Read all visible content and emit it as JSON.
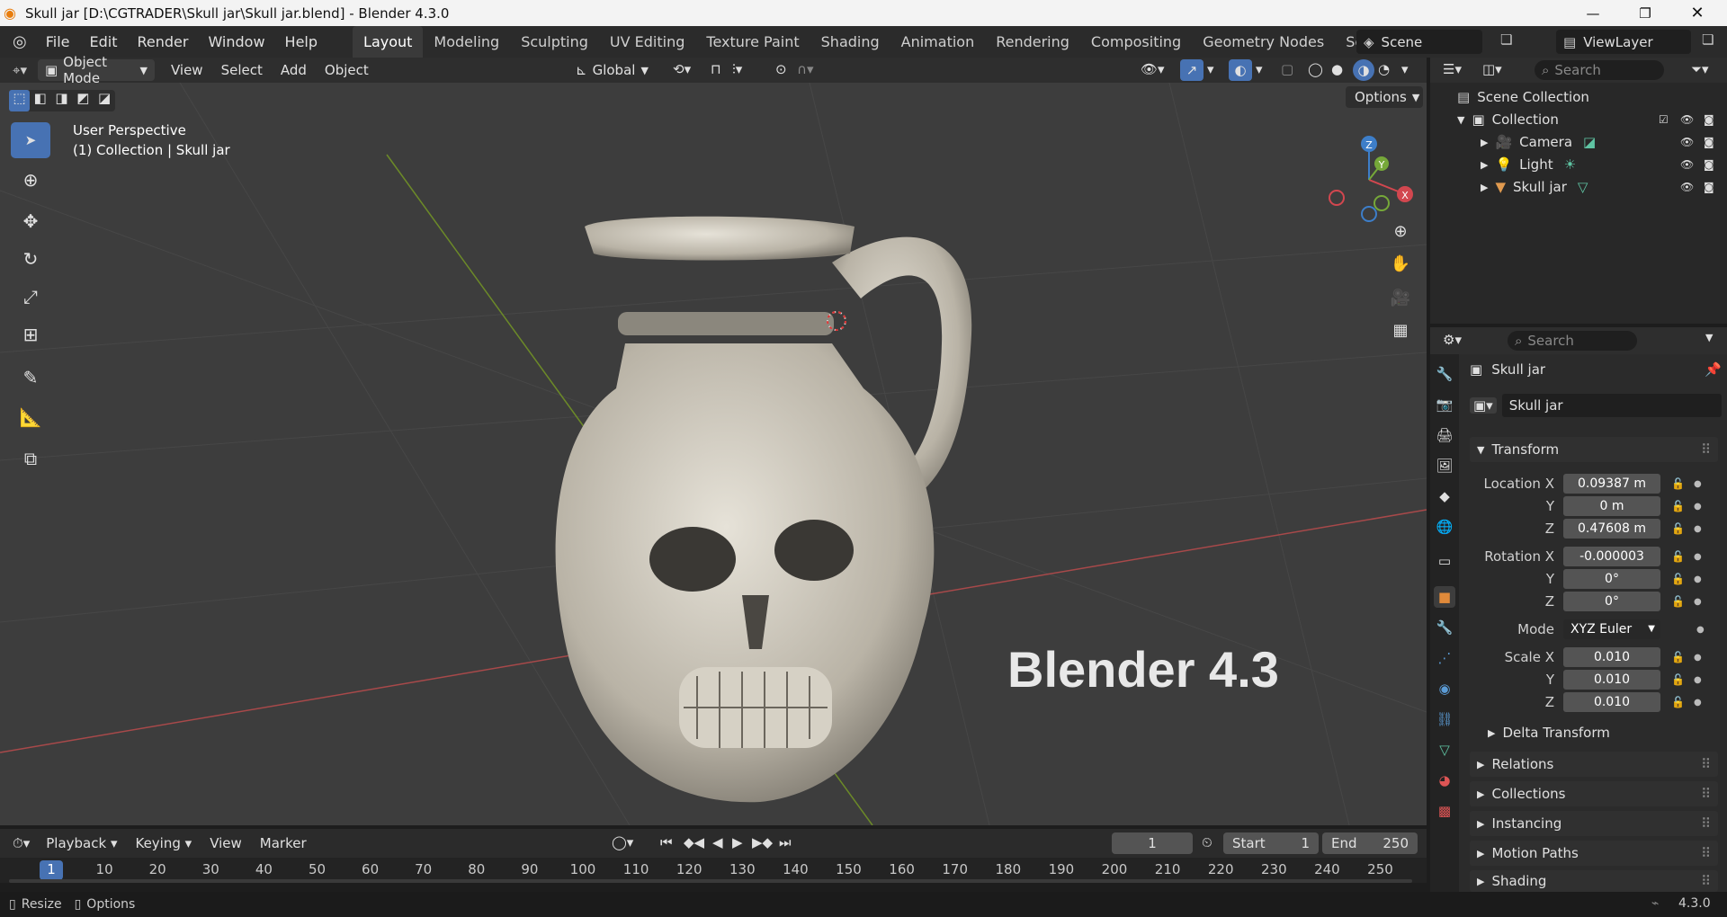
{
  "window": {
    "title": "Skull jar [D:\\CGTRADER\\Skull jar\\Skull jar.blend] - Blender 4.3.0"
  },
  "menu": [
    "File",
    "Edit",
    "Render",
    "Window",
    "Help"
  ],
  "workspaces": [
    "Layout",
    "Modeling",
    "Sculpting",
    "UV Editing",
    "Texture Paint",
    "Shading",
    "Animation",
    "Rendering",
    "Compositing",
    "Geometry Nodes",
    "Scripting"
  ],
  "scene": {
    "name": "Scene",
    "viewlayer": "ViewLayer"
  },
  "viewport": {
    "mode": "Object Mode",
    "menus": [
      "View",
      "Select",
      "Add",
      "Object"
    ],
    "orientation": "Global",
    "options": "Options",
    "overlay_line1": "User Perspective",
    "overlay_line2": "(1) Collection | Skull jar",
    "watermark": "Blender 4.3",
    "gizmo": {
      "z": "Z",
      "y": "Y",
      "x": "X"
    }
  },
  "outliner": {
    "search": "Search",
    "scene_collection": "Scene Collection",
    "collection": "Collection",
    "items": [
      "Camera",
      "Light",
      "Skull jar"
    ]
  },
  "properties": {
    "search": "Search",
    "object_name": "Skull jar",
    "data_name": "Skull jar",
    "transform": "Transform",
    "location": {
      "label": "Location X",
      "x": "0.09387 m",
      "y": "0 m",
      "z": "0.47608 m"
    },
    "rotation": {
      "label": "Rotation X",
      "x": "-0.000003",
      "y": "0°",
      "z": "0°"
    },
    "mode": {
      "label": "Mode",
      "value": "XYZ Euler"
    },
    "scale": {
      "label": "Scale X",
      "x": "0.010",
      "y": "0.010",
      "z": "0.010"
    },
    "axis_y": "Y",
    "axis_z": "Z",
    "panels": [
      "Delta Transform",
      "Relations",
      "Collections",
      "Instancing",
      "Motion Paths",
      "Shading"
    ]
  },
  "timeline": {
    "menus": [
      "Playback",
      "Keying",
      "View",
      "Marker"
    ],
    "current_frame": "1",
    "start_label": "Start",
    "start": "1",
    "end_label": "End",
    "end": "250",
    "ticks": [
      "1",
      "10",
      "20",
      "30",
      "40",
      "50",
      "60",
      "70",
      "80",
      "90",
      "100",
      "110",
      "120",
      "130",
      "140",
      "150",
      "160",
      "170",
      "180",
      "190",
      "200",
      "210",
      "220",
      "230",
      "240",
      "250"
    ]
  },
  "status": {
    "resize": "Resize",
    "options": "Options",
    "version": "4.3.0"
  }
}
